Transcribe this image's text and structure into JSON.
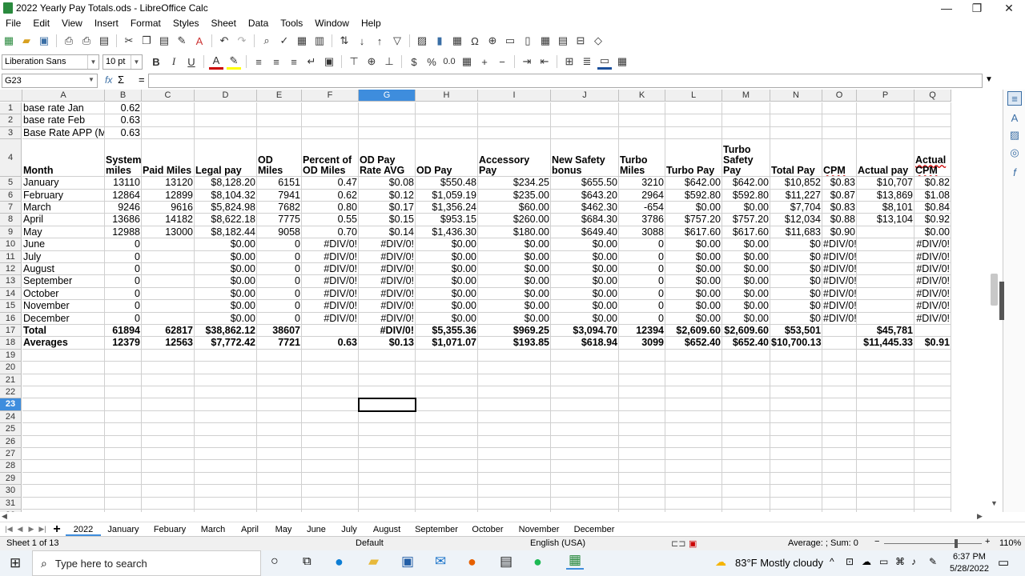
{
  "window": {
    "title": "2022 Yearly Pay Totals.ods - LibreOffice Calc",
    "minimize": "—",
    "maximize": "❐",
    "close": "✕"
  },
  "menu": [
    "File",
    "Edit",
    "View",
    "Insert",
    "Format",
    "Styles",
    "Sheet",
    "Data",
    "Tools",
    "Window",
    "Help"
  ],
  "format_toolbar": {
    "font_name": "Liberation Sans",
    "font_size": "10 pt",
    "bold": "B",
    "italic": "I",
    "underline": "U",
    "percent": "%",
    "number_format": "0.0"
  },
  "formula_bar": {
    "name_box": "G23",
    "fx": "fx",
    "sigma": "Σ",
    "equals": "=",
    "content": ""
  },
  "grid": {
    "columns": [
      "A",
      "B",
      "C",
      "D",
      "E",
      "F",
      "G",
      "H",
      "I",
      "J",
      "K",
      "L",
      "M",
      "N",
      "O",
      "P",
      "Q"
    ],
    "selected_column": "G",
    "selected_row": "23",
    "rows": [
      {
        "n": "1",
        "cells": [
          "base rate Jan",
          "0.62",
          "",
          "",
          "",
          "",
          "",
          "",
          "",
          "",
          "",
          "",
          "",
          "",
          "",
          "",
          ""
        ]
      },
      {
        "n": "2",
        "cells": [
          "base rate Feb",
          "0.63",
          "",
          "",
          "",
          "",
          "",
          "",
          "",
          "",
          "",
          "",
          "",
          "",
          "",
          "",
          ""
        ]
      },
      {
        "n": "3",
        "cells": [
          "Base Rate APP (M",
          "0.63",
          "",
          "",
          "",
          "",
          "",
          "",
          "",
          "",
          "",
          "",
          "",
          "",
          "",
          "",
          ""
        ]
      },
      {
        "n": "4",
        "cells": [
          "Month",
          "System miles",
          "Paid Miles",
          "Legal pay",
          "OD Miles",
          "Percent of OD Miles",
          "OD Pay Rate AVG",
          "OD Pay",
          "Accessory Pay",
          "New Safety bonus",
          "Turbo Miles",
          "Turbo Pay",
          "Turbo Safety Pay",
          "Total Pay",
          "CPM",
          "Actual pay",
          "Actual CPM"
        ]
      },
      {
        "n": "5",
        "cells": [
          "January",
          "13110",
          "13120",
          "$8,128.20",
          "6151",
          "0.47",
          "$0.08",
          "$550.48",
          "$234.25",
          "$655.50",
          "3210",
          "$642.00",
          "$642.00",
          "$10,852",
          "$0.83",
          "$10,707",
          "$0.82"
        ]
      },
      {
        "n": "6",
        "cells": [
          "February",
          "12864",
          "12899",
          "$8,104.32",
          "7941",
          "0.62",
          "$0.12",
          "$1,059.19",
          "$235.00",
          "$643.20",
          "2964",
          "$592.80",
          "$592.80",
          "$11,227",
          "$0.87",
          "$13,869",
          "$1.08"
        ]
      },
      {
        "n": "7",
        "cells": [
          "March",
          "9246",
          "9616",
          "$5,824.98",
          "7682",
          "0.80",
          "$0.17",
          "$1,356.24",
          "$60.00",
          "$462.30",
          "-654",
          "$0.00",
          "$0.00",
          "$7,704",
          "$0.83",
          "$8,101",
          "$0.84"
        ]
      },
      {
        "n": "8",
        "cells": [
          "April",
          "13686",
          "14182",
          "$8,622.18",
          "7775",
          "0.55",
          "$0.15",
          "$953.15",
          "$260.00",
          "$684.30",
          "3786",
          "$757.20",
          "$757.20",
          "$12,034",
          "$0.88",
          "$13,104",
          "$0.92"
        ]
      },
      {
        "n": "9",
        "cells": [
          "May",
          "12988",
          "13000",
          "$8,182.44",
          "9058",
          "0.70",
          "$0.14",
          "$1,436.30",
          "$180.00",
          "$649.40",
          "3088",
          "$617.60",
          "$617.60",
          "$11,683",
          "$0.90",
          "",
          "$0.00"
        ]
      },
      {
        "n": "10",
        "cells": [
          "June",
          "0",
          "",
          "$0.00",
          "0",
          "#DIV/0!",
          "#DIV/0!",
          "$0.00",
          "$0.00",
          "$0.00",
          "0",
          "$0.00",
          "$0.00",
          "$0",
          "#DIV/0!",
          "",
          "#DIV/0!"
        ]
      },
      {
        "n": "11",
        "cells": [
          "July",
          "0",
          "",
          "$0.00",
          "0",
          "#DIV/0!",
          "#DIV/0!",
          "$0.00",
          "$0.00",
          "$0.00",
          "0",
          "$0.00",
          "$0.00",
          "$0",
          "#DIV/0!",
          "",
          "#DIV/0!"
        ]
      },
      {
        "n": "12",
        "cells": [
          "August",
          "0",
          "",
          "$0.00",
          "0",
          "#DIV/0!",
          "#DIV/0!",
          "$0.00",
          "$0.00",
          "$0.00",
          "0",
          "$0.00",
          "$0.00",
          "$0",
          "#DIV/0!",
          "",
          "#DIV/0!"
        ]
      },
      {
        "n": "13",
        "cells": [
          "September",
          "0",
          "",
          "$0.00",
          "0",
          "#DIV/0!",
          "#DIV/0!",
          "$0.00",
          "$0.00",
          "$0.00",
          "0",
          "$0.00",
          "$0.00",
          "$0",
          "#DIV/0!",
          "",
          "#DIV/0!"
        ]
      },
      {
        "n": "14",
        "cells": [
          "October",
          "0",
          "",
          "$0.00",
          "0",
          "#DIV/0!",
          "#DIV/0!",
          "$0.00",
          "$0.00",
          "$0.00",
          "0",
          "$0.00",
          "$0.00",
          "$0",
          "#DIV/0!",
          "",
          "#DIV/0!"
        ]
      },
      {
        "n": "15",
        "cells": [
          "November",
          "0",
          "",
          "$0.00",
          "0",
          "#DIV/0!",
          "#DIV/0!",
          "$0.00",
          "$0.00",
          "$0.00",
          "0",
          "$0.00",
          "$0.00",
          "$0",
          "#DIV/0!",
          "",
          "#DIV/0!"
        ]
      },
      {
        "n": "16",
        "cells": [
          "December",
          "0",
          "",
          "$0.00",
          "0",
          "#DIV/0!",
          "#DIV/0!",
          "$0.00",
          "$0.00",
          "$0.00",
          "0",
          "$0.00",
          "$0.00",
          "$0",
          "#DIV/0!",
          "",
          "#DIV/0!"
        ]
      },
      {
        "n": "17",
        "cells": [
          "Total",
          "61894",
          "62817",
          "$38,862.12",
          "38607",
          "",
          "#DIV/0!",
          "$5,355.36",
          "$969.25",
          "$3,094.70",
          "12394",
          "$2,609.60",
          "$2,609.60",
          "$53,501",
          "",
          "$45,781",
          ""
        ]
      },
      {
        "n": "18",
        "cells": [
          "Averages",
          "12379",
          "12563",
          "$7,772.42",
          "7721",
          "0.63",
          "$0.13",
          "$1,071.07",
          "$193.85",
          "$618.94",
          "3099",
          "$652.40",
          "$652.40",
          "$10,700.13",
          "",
          "$11,445.33",
          "$0.91"
        ]
      },
      {
        "n": "19",
        "cells": []
      },
      {
        "n": "20",
        "cells": []
      },
      {
        "n": "21",
        "cells": []
      },
      {
        "n": "22",
        "cells": []
      },
      {
        "n": "23",
        "cells": []
      },
      {
        "n": "24",
        "cells": []
      },
      {
        "n": "25",
        "cells": []
      },
      {
        "n": "26",
        "cells": []
      },
      {
        "n": "27",
        "cells": []
      },
      {
        "n": "28",
        "cells": []
      },
      {
        "n": "29",
        "cells": []
      },
      {
        "n": "30",
        "cells": []
      },
      {
        "n": "31",
        "cells": []
      },
      {
        "n": "32",
        "cells": []
      }
    ]
  },
  "sheet_tabs": [
    "2022",
    "January",
    "Febuary",
    "March",
    "April",
    "May",
    "June",
    "July",
    "August",
    "September",
    "October",
    "November",
    "December"
  ],
  "active_tab": "2022",
  "status": {
    "sheet": "Sheet 1 of 13",
    "style": "Default",
    "language": "English (USA)",
    "summary": "Average: ; Sum: 0",
    "zoom": "110%"
  },
  "taskbar": {
    "search_placeholder": "Type here to search",
    "weather": "83°F  Mostly cloudy",
    "time": "6:37 PM",
    "date": "5/28/2022"
  },
  "colors": {
    "accent": "#3e8ddd",
    "calc_green": "#2a8a3e"
  }
}
